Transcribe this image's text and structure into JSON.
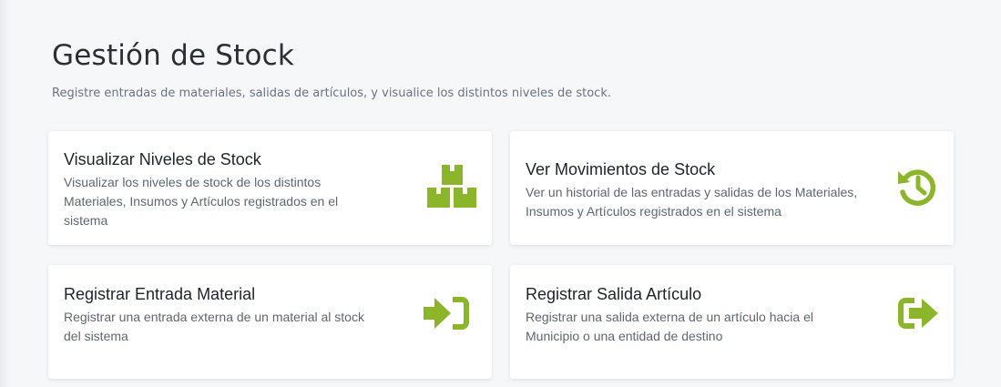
{
  "header": {
    "title": "Gestión de Stock",
    "subtitle": "Registre entradas de materiales, salidas de artículos, y visualice los distintos niveles de stock."
  },
  "colors": {
    "accent": "#8cb62a",
    "background": "#f6f7f9",
    "card": "#ffffff"
  },
  "cards": [
    {
      "title": "Visualizar Niveles de Stock",
      "description": "Visualizar los niveles de stock de los distintos Materiales, Insumos y Artículos registrados en el sistema",
      "icon": "boxes-icon"
    },
    {
      "title": "Ver Movimientos de Stock",
      "description": "Ver un historial de las entradas y salidas de los Materiales, Insumos y Artículos registrados en el sistema",
      "icon": "history-icon"
    },
    {
      "title": "Registrar Entrada Material",
      "description": "Registrar una entrada externa de un material al stock del sistema",
      "icon": "sign-in-icon"
    },
    {
      "title": "Registrar Salida Artículo",
      "description": "Registrar una salida externa de un artículo hacia el Municipio o una entidad de destino",
      "icon": "sign-out-icon"
    }
  ]
}
